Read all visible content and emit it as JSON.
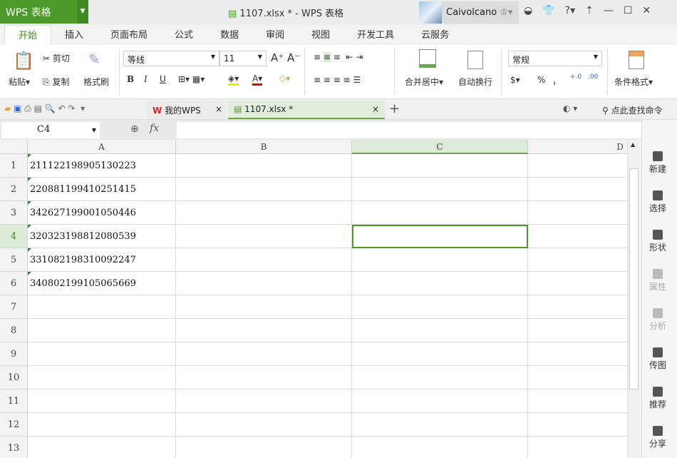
{
  "app": {
    "logo": "WPS 表格",
    "title": "1107.xlsx * - WPS 表格",
    "user": "Caivolcano"
  },
  "menu_tabs": [
    "开始",
    "插入",
    "页面布局",
    "公式",
    "数据",
    "审阅",
    "视图",
    "开发工具",
    "云服务"
  ],
  "ribbon": {
    "paste": "粘贴",
    "cut": "剪切",
    "copy": "复制",
    "format_painter": "格式刷",
    "font": "等线",
    "size": "11",
    "bold": "B",
    "italic": "I",
    "underline": "U",
    "merge": "合并居中",
    "wrap": "自动换行",
    "number_format": "常规",
    "percent": "%",
    "comma": "，",
    "inc_dec": "+.0",
    "dec_dec": ".00",
    "cond_format": "条件格式"
  },
  "doc_tabs": [
    {
      "label": "我的WPS"
    },
    {
      "label": "1107.xlsx *"
    }
  ],
  "search_cmd": "点此查找命令",
  "formula_bar": {
    "name_box": "C4",
    "fx": "fx",
    "value": ""
  },
  "columns": [
    "A",
    "B",
    "C",
    "D"
  ],
  "rows": [
    "1",
    "2",
    "3",
    "4",
    "5",
    "6",
    "7",
    "8",
    "9",
    "10",
    "11",
    "12",
    "13"
  ],
  "cells_A": [
    "211122198905130223",
    "220881199410251415",
    "342627199001050446",
    "320323198812080539",
    "331082198310092247",
    "340802199105065669"
  ],
  "selected_cell": "C4",
  "sidebar": [
    {
      "label": "新建",
      "enabled": true
    },
    {
      "label": "选择",
      "enabled": true
    },
    {
      "label": "形状",
      "enabled": true
    },
    {
      "label": "属性",
      "enabled": false
    },
    {
      "label": "分析",
      "enabled": false
    },
    {
      "label": "传图",
      "enabled": true
    },
    {
      "label": "推荐",
      "enabled": true
    },
    {
      "label": "分享",
      "enabled": true
    }
  ],
  "colors": {
    "accent": "#4c9a2a"
  }
}
